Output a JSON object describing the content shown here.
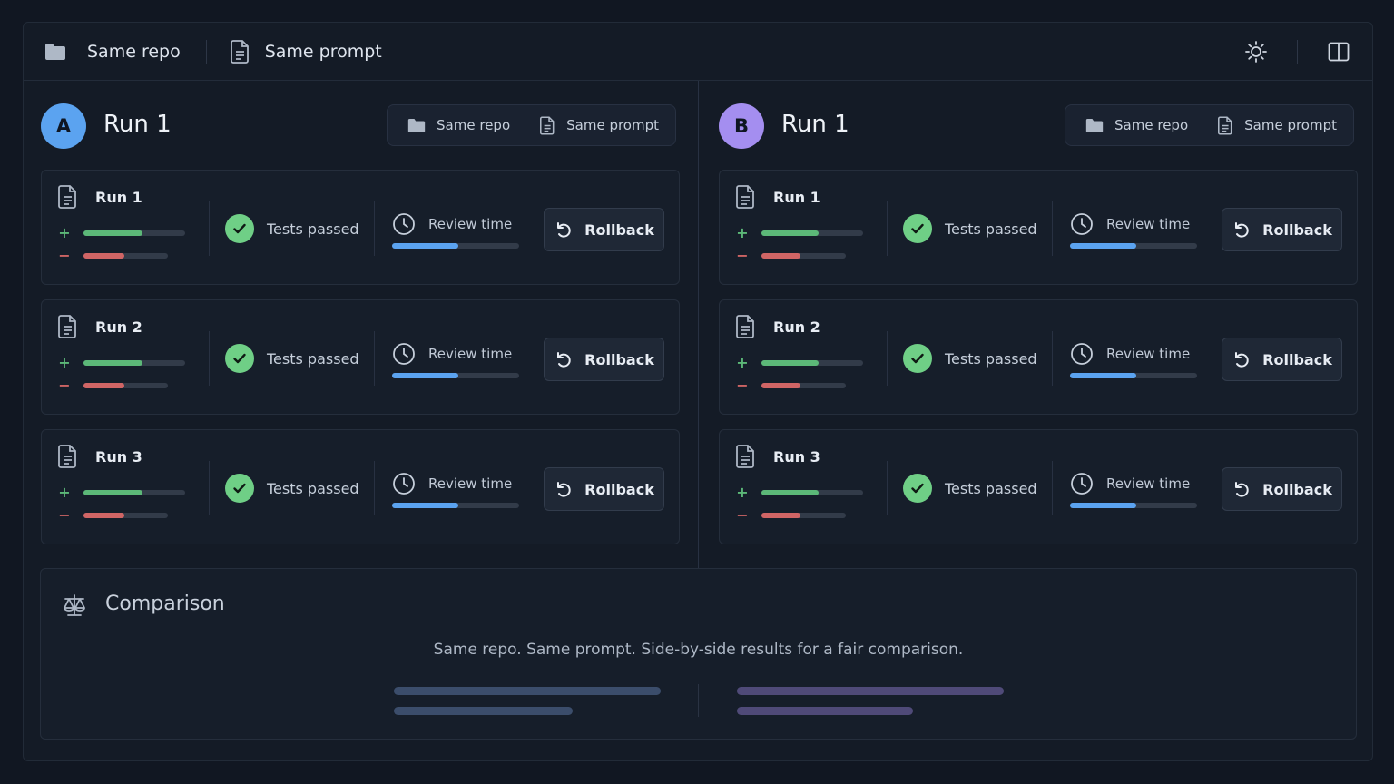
{
  "topbar": {
    "repo_label": "Same repo",
    "prompt_label": "Same prompt",
    "theme_icon": "sun-icon",
    "layout_icon": "split-layout-icon"
  },
  "panels": [
    {
      "avatar": "A",
      "avatar_color": "#5ba3f0",
      "title": "Run 1",
      "chips": {
        "repo": "Same repo",
        "prompt": "Same prompt"
      },
      "runs": [
        {
          "name": "Run 1",
          "added": 0.58,
          "removed": 0.48,
          "tests": "Tests passed",
          "review_label": "Review time",
          "review": 0.52,
          "rollback": "Rollback"
        },
        {
          "name": "Run 2",
          "added": 0.58,
          "removed": 0.48,
          "tests": "Tests passed",
          "review_label": "Review time",
          "review": 0.52,
          "rollback": "Rollback"
        },
        {
          "name": "Run 3",
          "added": 0.58,
          "removed": 0.48,
          "tests": "Tests passed",
          "review_label": "Review time",
          "review": 0.52,
          "rollback": "Rollback"
        }
      ]
    },
    {
      "avatar": "B",
      "avatar_color": "#a48ef0",
      "title": "Run 1",
      "chips": {
        "repo": "Same repo",
        "prompt": "Same prompt"
      },
      "runs": [
        {
          "name": "Run 1",
          "added": 0.56,
          "removed": 0.46,
          "tests": "Tests passed",
          "review_label": "Review time",
          "review": 0.52,
          "rollback": "Rollback"
        },
        {
          "name": "Run 2",
          "added": 0.56,
          "removed": 0.46,
          "tests": "Tests passed",
          "review_label": "Review time",
          "review": 0.52,
          "rollback": "Rollback"
        },
        {
          "name": "Run 3",
          "added": 0.56,
          "removed": 0.46,
          "tests": "Tests passed",
          "review_label": "Review time",
          "review": 0.52,
          "rollback": "Rollback"
        }
      ]
    }
  ],
  "comparison": {
    "title": "Comparison",
    "text": "Same repo. Same prompt. Side-by-side results for a fair comparison.",
    "a_color": "#3b4d6b",
    "b_color": "#4f4a78"
  },
  "colors": {
    "added": "#5cb878",
    "removed": "#d06565",
    "review": "#5ba3f0",
    "check": "#6fcf86"
  }
}
